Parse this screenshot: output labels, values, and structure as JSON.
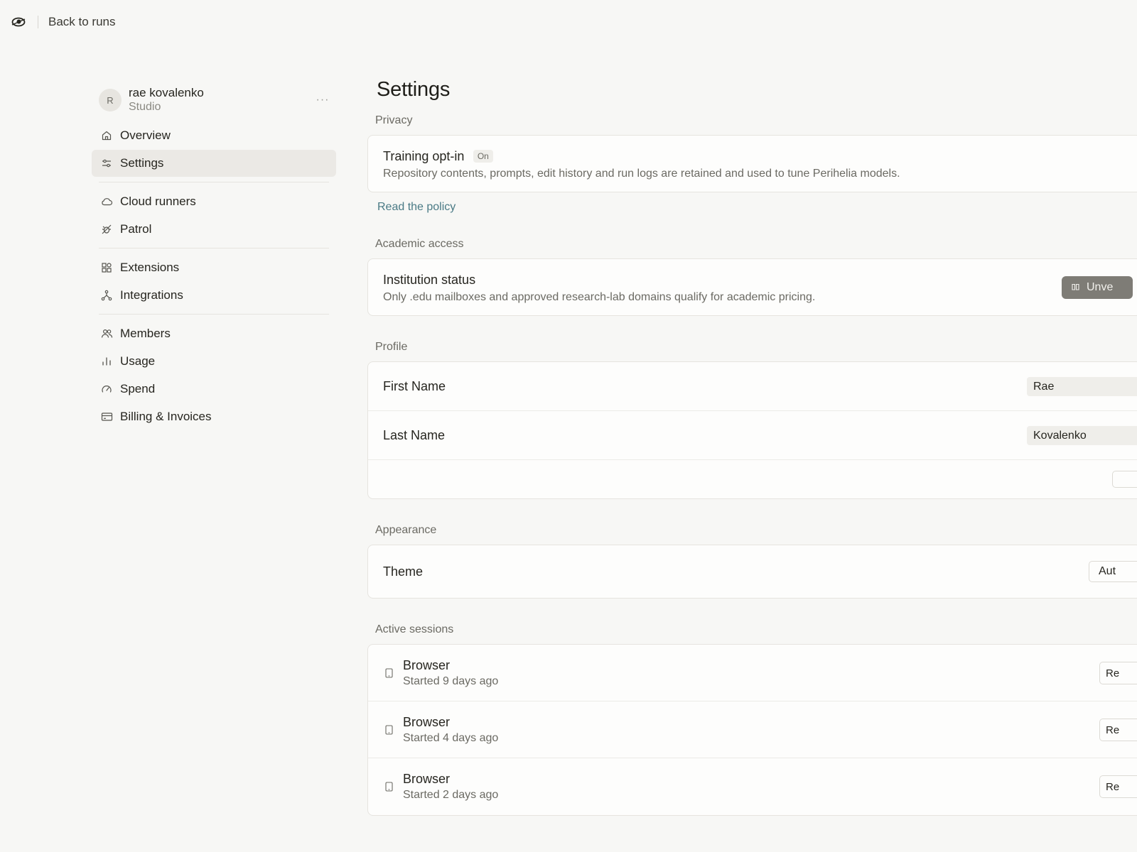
{
  "topbar": {
    "back_label": "Back to runs"
  },
  "profile": {
    "initial": "R",
    "name": "rae kovalenko",
    "org": "Studio",
    "more": "···"
  },
  "nav": {
    "overview": "Overview",
    "settings": "Settings",
    "cloud_runners": "Cloud runners",
    "patrol": "Patrol",
    "extensions": "Extensions",
    "integrations": "Integrations",
    "members": "Members",
    "usage": "Usage",
    "spend": "Spend",
    "billing": "Billing & Invoices"
  },
  "page": {
    "title": "Settings"
  },
  "privacy": {
    "section": "Privacy",
    "title": "Training opt-in",
    "badge": "On",
    "description": "Repository contents, prompts, edit history and run logs are retained and used to tune Perihelia models.",
    "link": "Read the policy"
  },
  "academic": {
    "section": "Academic access",
    "title": "Institution status",
    "description": "Only .edu mailboxes and approved research-lab domains qualify for academic pricing.",
    "button": "Unve"
  },
  "profile_section": {
    "section": "Profile",
    "first_name_label": "First Name",
    "first_name_value": "Rae",
    "last_name_label": "Last Name",
    "last_name_value": "Kovalenko"
  },
  "appearance": {
    "section": "Appearance",
    "theme_label": "Theme",
    "theme_value": "Aut"
  },
  "sessions": {
    "section": "Active sessions",
    "items": [
      {
        "name": "Browser",
        "started": "Started 9 days ago",
        "action": "Re"
      },
      {
        "name": "Browser",
        "started": "Started 4 days ago",
        "action": "Re"
      },
      {
        "name": "Browser",
        "started": "Started 2 days ago",
        "action": "Re"
      }
    ]
  }
}
